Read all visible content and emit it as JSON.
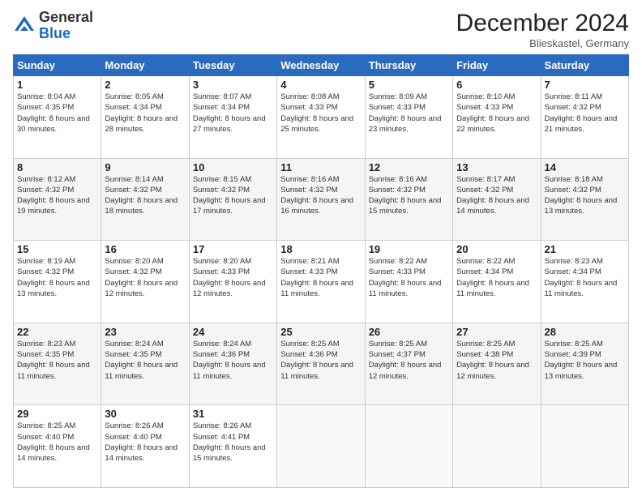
{
  "logo": {
    "general": "General",
    "blue": "Blue"
  },
  "header": {
    "title": "December 2024",
    "location": "Blieskastel, Germany"
  },
  "weekdays": [
    "Sunday",
    "Monday",
    "Tuesday",
    "Wednesday",
    "Thursday",
    "Friday",
    "Saturday"
  ],
  "weeks": [
    [
      {
        "day": "1",
        "sunrise": "Sunrise: 8:04 AM",
        "sunset": "Sunset: 4:35 PM",
        "daylight": "Daylight: 8 hours and 30 minutes."
      },
      {
        "day": "2",
        "sunrise": "Sunrise: 8:05 AM",
        "sunset": "Sunset: 4:34 PM",
        "daylight": "Daylight: 8 hours and 28 minutes."
      },
      {
        "day": "3",
        "sunrise": "Sunrise: 8:07 AM",
        "sunset": "Sunset: 4:34 PM",
        "daylight": "Daylight: 8 hours and 27 minutes."
      },
      {
        "day": "4",
        "sunrise": "Sunrise: 8:08 AM",
        "sunset": "Sunset: 4:33 PM",
        "daylight": "Daylight: 8 hours and 25 minutes."
      },
      {
        "day": "5",
        "sunrise": "Sunrise: 8:09 AM",
        "sunset": "Sunset: 4:33 PM",
        "daylight": "Daylight: 8 hours and 23 minutes."
      },
      {
        "day": "6",
        "sunrise": "Sunrise: 8:10 AM",
        "sunset": "Sunset: 4:33 PM",
        "daylight": "Daylight: 8 hours and 22 minutes."
      },
      {
        "day": "7",
        "sunrise": "Sunrise: 8:11 AM",
        "sunset": "Sunset: 4:32 PM",
        "daylight": "Daylight: 8 hours and 21 minutes."
      }
    ],
    [
      {
        "day": "8",
        "sunrise": "Sunrise: 8:12 AM",
        "sunset": "Sunset: 4:32 PM",
        "daylight": "Daylight: 8 hours and 19 minutes."
      },
      {
        "day": "9",
        "sunrise": "Sunrise: 8:14 AM",
        "sunset": "Sunset: 4:32 PM",
        "daylight": "Daylight: 8 hours and 18 minutes."
      },
      {
        "day": "10",
        "sunrise": "Sunrise: 8:15 AM",
        "sunset": "Sunset: 4:32 PM",
        "daylight": "Daylight: 8 hours and 17 minutes."
      },
      {
        "day": "11",
        "sunrise": "Sunrise: 8:16 AM",
        "sunset": "Sunset: 4:32 PM",
        "daylight": "Daylight: 8 hours and 16 minutes."
      },
      {
        "day": "12",
        "sunrise": "Sunrise: 8:16 AM",
        "sunset": "Sunset: 4:32 PM",
        "daylight": "Daylight: 8 hours and 15 minutes."
      },
      {
        "day": "13",
        "sunrise": "Sunrise: 8:17 AM",
        "sunset": "Sunset: 4:32 PM",
        "daylight": "Daylight: 8 hours and 14 minutes."
      },
      {
        "day": "14",
        "sunrise": "Sunrise: 8:18 AM",
        "sunset": "Sunset: 4:32 PM",
        "daylight": "Daylight: 8 hours and 13 minutes."
      }
    ],
    [
      {
        "day": "15",
        "sunrise": "Sunrise: 8:19 AM",
        "sunset": "Sunset: 4:32 PM",
        "daylight": "Daylight: 8 hours and 13 minutes."
      },
      {
        "day": "16",
        "sunrise": "Sunrise: 8:20 AM",
        "sunset": "Sunset: 4:32 PM",
        "daylight": "Daylight: 8 hours and 12 minutes."
      },
      {
        "day": "17",
        "sunrise": "Sunrise: 8:20 AM",
        "sunset": "Sunset: 4:33 PM",
        "daylight": "Daylight: 8 hours and 12 minutes."
      },
      {
        "day": "18",
        "sunrise": "Sunrise: 8:21 AM",
        "sunset": "Sunset: 4:33 PM",
        "daylight": "Daylight: 8 hours and 11 minutes."
      },
      {
        "day": "19",
        "sunrise": "Sunrise: 8:22 AM",
        "sunset": "Sunset: 4:33 PM",
        "daylight": "Daylight: 8 hours and 11 minutes."
      },
      {
        "day": "20",
        "sunrise": "Sunrise: 8:22 AM",
        "sunset": "Sunset: 4:34 PM",
        "daylight": "Daylight: 8 hours and 11 minutes."
      },
      {
        "day": "21",
        "sunrise": "Sunrise: 8:23 AM",
        "sunset": "Sunset: 4:34 PM",
        "daylight": "Daylight: 8 hours and 11 minutes."
      }
    ],
    [
      {
        "day": "22",
        "sunrise": "Sunrise: 8:23 AM",
        "sunset": "Sunset: 4:35 PM",
        "daylight": "Daylight: 8 hours and 11 minutes."
      },
      {
        "day": "23",
        "sunrise": "Sunrise: 8:24 AM",
        "sunset": "Sunset: 4:35 PM",
        "daylight": "Daylight: 8 hours and 11 minutes."
      },
      {
        "day": "24",
        "sunrise": "Sunrise: 8:24 AM",
        "sunset": "Sunset: 4:36 PM",
        "daylight": "Daylight: 8 hours and 11 minutes."
      },
      {
        "day": "25",
        "sunrise": "Sunrise: 8:25 AM",
        "sunset": "Sunset: 4:36 PM",
        "daylight": "Daylight: 8 hours and 11 minutes."
      },
      {
        "day": "26",
        "sunrise": "Sunrise: 8:25 AM",
        "sunset": "Sunset: 4:37 PM",
        "daylight": "Daylight: 8 hours and 12 minutes."
      },
      {
        "day": "27",
        "sunrise": "Sunrise: 8:25 AM",
        "sunset": "Sunset: 4:38 PM",
        "daylight": "Daylight: 8 hours and 12 minutes."
      },
      {
        "day": "28",
        "sunrise": "Sunrise: 8:25 AM",
        "sunset": "Sunset: 4:39 PM",
        "daylight": "Daylight: 8 hours and 13 minutes."
      }
    ],
    [
      {
        "day": "29",
        "sunrise": "Sunrise: 8:25 AM",
        "sunset": "Sunset: 4:40 PM",
        "daylight": "Daylight: 8 hours and 14 minutes."
      },
      {
        "day": "30",
        "sunrise": "Sunrise: 8:26 AM",
        "sunset": "Sunset: 4:40 PM",
        "daylight": "Daylight: 8 hours and 14 minutes."
      },
      {
        "day": "31",
        "sunrise": "Sunrise: 8:26 AM",
        "sunset": "Sunset: 4:41 PM",
        "daylight": "Daylight: 8 hours and 15 minutes."
      },
      null,
      null,
      null,
      null
    ]
  ]
}
